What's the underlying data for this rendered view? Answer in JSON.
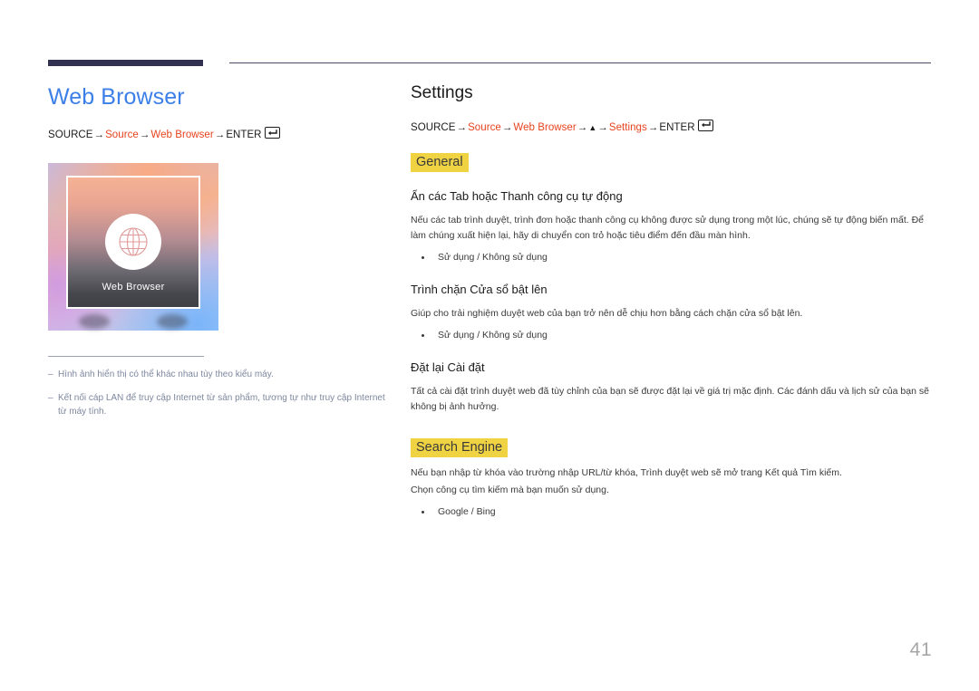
{
  "page": {
    "number": "41",
    "accent_blue": "#3d7fe8",
    "accent_red": "#e8431f",
    "highlight_yellow": "#f0d343",
    "rule_navy": "#323152"
  },
  "left": {
    "title": "Web Browser",
    "path": {
      "start": "SOURCE",
      "items": [
        "Source",
        "Web Browser"
      ],
      "end": "ENTER",
      "arrow": "→",
      "enter_icon": "enter-key-icon"
    },
    "thumbnail": {
      "label": "Web Browser",
      "icon": "globe-icon"
    },
    "notes": [
      {
        "dash": "‒",
        "text": "Hình ảnh hiển thị có thể khác nhau tùy theo kiểu máy."
      },
      {
        "dash": "‒",
        "text": "Kết nối cáp LAN để truy cập Internet từ sản phẩm, tương tự như truy cập Internet từ máy tính."
      }
    ]
  },
  "right": {
    "title": "Settings",
    "path": {
      "start": "SOURCE",
      "item1": "Source",
      "item2": "Web Browser",
      "triangle": "▲",
      "item3": "Settings",
      "end": "ENTER",
      "arrow": "→",
      "enter_icon": "enter-key-icon"
    },
    "general": {
      "chip": "General",
      "sections": [
        {
          "heading": "Ẩn các Tab hoặc Thanh công cụ tự động",
          "body": "Nếu các tab trình duyệt, trình đơn hoặc thanh công cụ không được sử dụng trong một lúc, chúng sẽ tự động biến mất. Để làm chúng xuất hiện lại, hãy di chuyển con trỏ hoặc tiêu điểm đến đầu màn hình.",
          "bullets": [
            "Sử dụng / Không sử dụng"
          ]
        },
        {
          "heading": "Trình chặn Cửa sổ bật lên",
          "body": "Giúp cho trải nghiệm duyệt web của bạn trở nên dễ chịu hơn bằng cách chặn cửa sổ bật lên.",
          "bullets": [
            "Sử dụng / Không sử dụng"
          ]
        },
        {
          "heading": "Đặt lại Cài đặt",
          "body": "Tất cả cài đặt trình duyệt web đã tùy chỉnh của bạn sẽ được đặt lại về giá trị mặc định. Các đánh dấu và lịch sử của bạn sẽ không bị ảnh hưởng.",
          "bullets": []
        }
      ]
    },
    "search_engine": {
      "chip": "Search Engine",
      "body1": "Nếu bạn nhập từ khóa vào trường nhập URL/từ khóa, Trình duyệt web sẽ mở trang Kết quả Tìm kiếm.",
      "body2": "Chọn công cụ tìm kiếm mà bạn muốn sử dụng.",
      "bullets": [
        "Google / Bing"
      ]
    }
  }
}
